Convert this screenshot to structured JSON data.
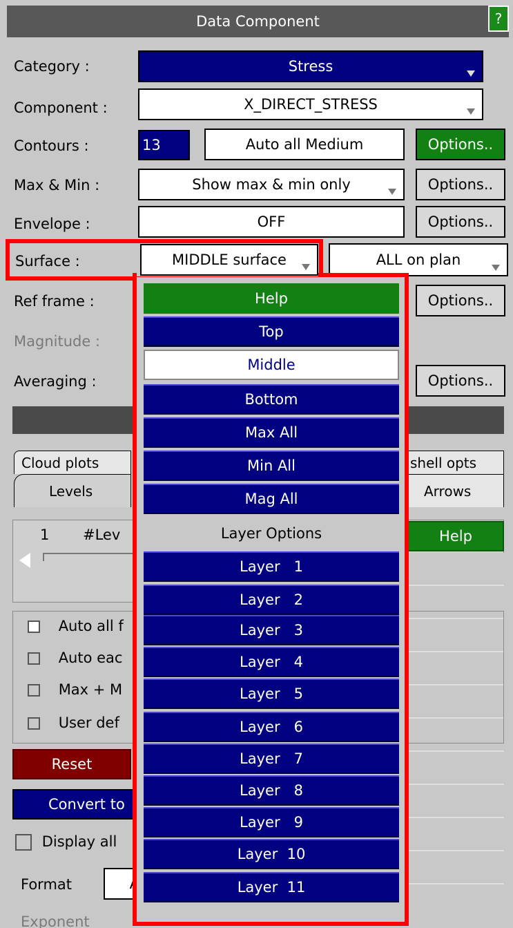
{
  "window": {
    "title": "Data Component",
    "help_label": "?"
  },
  "rows": {
    "category": {
      "label": "Category :",
      "value": "Stress"
    },
    "component": {
      "label": "Component :",
      "value": "X_DIRECT_STRESS"
    },
    "contours": {
      "label": "Contours :",
      "count": "13",
      "mode": "Auto all Medium",
      "options": "Options.."
    },
    "maxmin": {
      "label": "Max & Min :",
      "value": "Show max & min only",
      "options": "Options.."
    },
    "envelope": {
      "label": "Envelope :",
      "value": "OFF",
      "options": "Options.."
    },
    "surface": {
      "label": "Surface :",
      "value": "MIDDLE surface",
      "plan": "ALL on plan"
    },
    "refframe": {
      "label": "Ref frame :",
      "options": "Options.."
    },
    "magnitude": {
      "label": "Magnitude :"
    },
    "averaging": {
      "label": "Averaging :",
      "options": "Options.."
    }
  },
  "tabs": {
    "cloud_plots": "Cloud plots",
    "shell_opts": "shell opts",
    "levels": "Levels",
    "arrows": "Arrows"
  },
  "levels": {
    "one": "1",
    "num_levels": "#Lev",
    "help": "Help"
  },
  "checkboxes": [
    {
      "label": "Auto all f",
      "checked": true
    },
    {
      "label": "Auto eac",
      "checked": false
    },
    {
      "label": "Max + M",
      "checked": false
    },
    {
      "label": "User def",
      "checked": false
    }
  ],
  "buttons": {
    "reset": "Reset",
    "convert": "Convert to"
  },
  "display_all": "Display all",
  "format_label": "Format",
  "format_value": "A",
  "exponent_label": "Exponent",
  "dropdown": {
    "items": [
      "Help",
      "Top",
      "Middle",
      "Bottom",
      "Max All",
      "Min All",
      "Mag All",
      "Layer Options",
      "Layer   1",
      "Layer   2",
      "Layer   3",
      "Layer   4",
      "Layer   5",
      "Layer   6",
      "Layer   7",
      "Layer   8",
      "Layer   9",
      "Layer  10",
      "Layer  11"
    ]
  },
  "colors": {
    "navy": "#000080",
    "green": "#128012",
    "highlight": "#ff0000",
    "maroon": "#800000"
  }
}
